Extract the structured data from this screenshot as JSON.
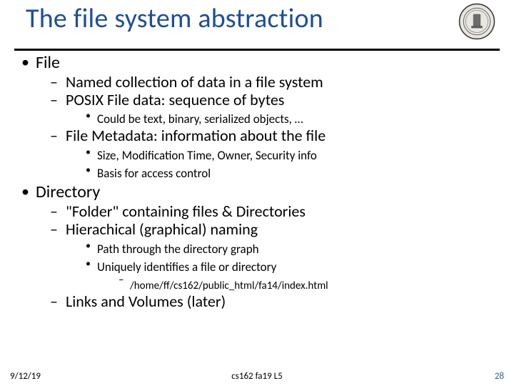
{
  "title": "The file system abstraction",
  "lvl1": [
    {
      "txt": "File",
      "lvl2": [
        {
          "txt": "Named collection of data in a file system"
        },
        {
          "txt": "POSIX File data: sequence of bytes",
          "lvl3": [
            {
              "txt": "Could be text, binary, serialized objects, …"
            }
          ]
        },
        {
          "txt": "File Metadata: information about the file",
          "lvl3": [
            {
              "txt": "Size, Modification Time, Owner, Security info"
            },
            {
              "txt": "Basis for access control"
            }
          ]
        }
      ]
    },
    {
      "txt": "Directory",
      "lvl2": [
        {
          "txt": "\"Folder\" containing files & Directories"
        },
        {
          "txt": "Hierachical (graphical) naming",
          "lvl3": [
            {
              "txt": "Path through the directory graph"
            },
            {
              "txt": "Uniquely identifies a file or directory",
              "lvl4": [
                {
                  "txt": "/home/ff/cs162/public_html/fa14/index.html"
                }
              ]
            }
          ]
        },
        {
          "txt": "Links and Volumes (later)"
        }
      ]
    }
  ],
  "footer": {
    "date": "9/12/19",
    "center": "cs162 fa19 L5",
    "pageno": "28"
  }
}
